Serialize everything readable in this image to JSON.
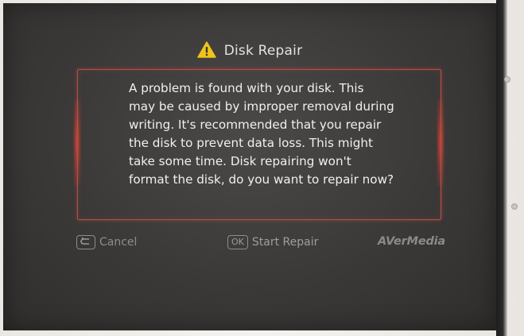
{
  "dialog": {
    "title": "Disk Repair",
    "title_icon": "warning-triangle-icon",
    "message_lines": [
      "A problem is found with your disk. This",
      "may be caused by improper removal during",
      "writing. It's recommended that you repair",
      "the disk to prevent data loss. This might",
      "take some time. Disk repairing won't",
      "format the disk, do you want to repair now?"
    ],
    "accent_color": "#f0c419",
    "frame_color": "#b0524a"
  },
  "footer": {
    "cancel_icon": "back-arrow-icon",
    "cancel_label": "Cancel",
    "ok_key": "OK",
    "start_repair_label": "Start Repair",
    "brand": "AVerMedia"
  }
}
